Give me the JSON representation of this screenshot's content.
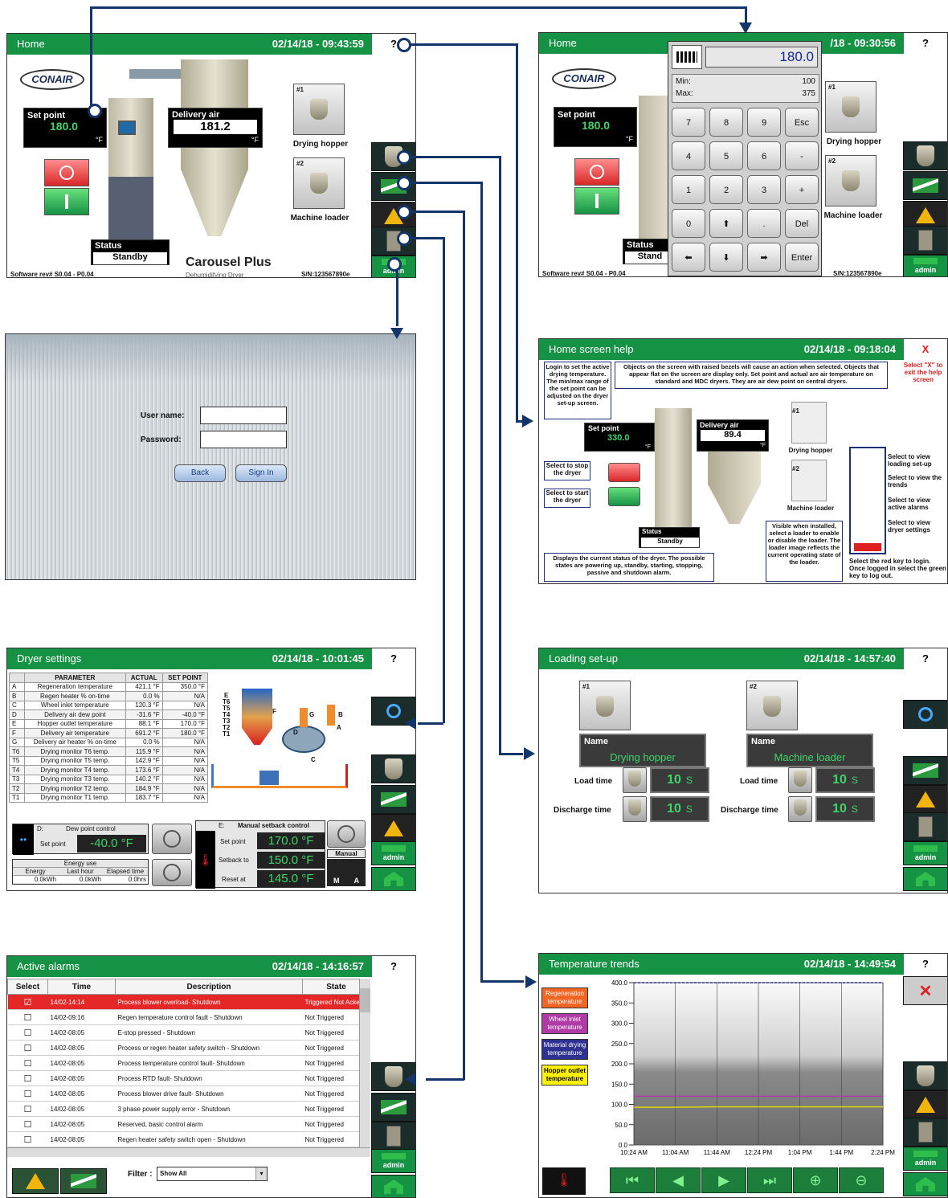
{
  "home": {
    "title": "Home",
    "datetime": "02/14/18 - 09:43:59",
    "help": "?",
    "logo": "CONAIR",
    "setpoint_label": "Set point",
    "setpoint_value": "180.0",
    "unit": "°F",
    "delivery_label": "Delivery air",
    "delivery_value": "181.2",
    "hopper_label": "Drying hopper",
    "loader_label": "Machine loader",
    "hopper_num": "#1",
    "loader_num": "#2",
    "status_label": "Status",
    "status_value": "Standby",
    "brand": "Carousel Plus",
    "brand_sub": "Dehumidifying Dryer",
    "sw": "Software rev# S0.04 - P0.04",
    "sn": "S/N:123567890e",
    "admin": "admin"
  },
  "keypad": {
    "title": "Home",
    "datetime": "/18 - 09:30:56",
    "help": "?",
    "value": "180.0",
    "min_label": "Min:",
    "min_value": "100",
    "max_label": "Max:",
    "max_value": "375",
    "keys": [
      "7",
      "8",
      "9",
      "Esc",
      "4",
      "5",
      "6",
      "-",
      "1",
      "2",
      "3",
      "+",
      "0",
      "⬆",
      ".",
      "Del",
      "⬅",
      "⬇",
      "➡",
      "Enter"
    ],
    "logo": "CONAIR",
    "setpoint_label": "Set point",
    "setpoint_value": "180.0",
    "unit": "°F",
    "hopper_label": "Drying hopper",
    "loader_label": "Machine loader",
    "hopper_num": "#1",
    "loader_num": "#2",
    "status_label": "Status",
    "status_value": "Stand",
    "sw": "Software rev# S0.04 - P0.04",
    "sn": "S/N:123567890e",
    "admin": "admin"
  },
  "login": {
    "user_label": "User name:",
    "pass_label": "Password:",
    "back": "Back",
    "signin": "Sign In"
  },
  "help": {
    "title": "Home screen help",
    "datetime": "02/14/18 - 09:18:04",
    "close": "X",
    "exit_note": "Select \"X\" to exit the help screen",
    "note_login": "Login to set the active drying temperature. The min/max range of the set point can be adjusted on the dryer set-up screen.",
    "note_objects": "Objects on the screen with raised bezels will cause an action when selected. Objects that appear flat on the screen are display only. Set point and actual are air temperature on standard and MDC dryers. They are air dew point on central dryers.",
    "setpoint_label": "Set point",
    "setpoint_value": "330.0",
    "delivery_label": "Delivery air",
    "delivery_value": "89.4",
    "unit": "°F",
    "stop_note": "Select to stop the dryer",
    "start_note": "Select to start the dryer",
    "hopper_label": "Drying hopper",
    "loader_label": "Machine loader",
    "hopper_num": "#1",
    "loader_num": "#2",
    "status_label": "Status",
    "status_value": "Standby",
    "status_note": "Displays the current status of the dryer. The possible states are powering up, standby, starting, stopping, passive and shutdown alarm.",
    "loader_note": "Visible when installed, select a loader to enable or disable the loader. The loader image reflects the current operating state of the loader.",
    "n1": "Select to view loading set-up",
    "n2": "Select to view the trends",
    "n3": "Select to view active alarms",
    "n4": "Select to view dryer settings",
    "key_note": "Select the red key to login. Once logged in select the green key to log out."
  },
  "dryer": {
    "title": "Dryer settings",
    "datetime": "02/14/18 - 10:01:45",
    "help": "?",
    "headers": [
      "PARAMETER",
      "ACTUAL",
      "SET POINT"
    ],
    "rows": [
      [
        "A",
        "Regeneration temperature",
        "421.1 °F",
        "350.0 °F"
      ],
      [
        "B",
        "Regen heater % on-time",
        "0.0 %",
        "N/A"
      ],
      [
        "C",
        "Wheel inlet temperature",
        "120.3 °F",
        "N/A"
      ],
      [
        "D",
        "Delivery air dew point",
        "-31.6 °F",
        "-40.0 °F"
      ],
      [
        "E",
        "Hopper outlet temperature",
        "88.1 °F",
        "170.0 °F"
      ],
      [
        "F",
        "Delivery air temperature",
        "691.2 °F",
        "180.0 °F"
      ],
      [
        "G",
        "Delivery air heater % on-time",
        "0.0 %",
        "N/A"
      ],
      [
        "T6",
        "Drying monitor T6 temp.",
        "115.9 °F",
        "N/A"
      ],
      [
        "T5",
        "Drying monitor T5 temp.",
        "142.9 °F",
        "N/A"
      ],
      [
        "T4",
        "Drying monitor T4 temp.",
        "173.6 °F",
        "N/A"
      ],
      [
        "T3",
        "Drying monitor T3 temp.",
        "140.2 °F",
        "N/A"
      ],
      [
        "T2",
        "Drying monitor T2 temp.",
        "184.9 °F",
        "N/A"
      ],
      [
        "T1",
        "Drying monitor T1 temp.",
        "183.7 °F",
        "N/A"
      ]
    ],
    "dp_tag": "D:",
    "dp_title": "Dew point control",
    "dp_sp_label": "Set point",
    "dp_sp": "-40.0 °F",
    "energy_title": "Energy use",
    "energy_h": [
      "Energy",
      "Last hour",
      "Elapsed time"
    ],
    "energy_v": [
      "0.0kWh",
      "0.0kWh",
      "0.0hrs"
    ],
    "ms_tag": "E:",
    "ms_title": "Manual setback control",
    "ms_sp_label": "Set point",
    "ms_sp": "170.0 °F",
    "ms_sb_label": "Setback to",
    "ms_sb": "150.0 °F",
    "ms_rs_label": "Reset at",
    "ms_rs": "145.0 °F",
    "manual": "Manual",
    "m": "M",
    "a": "A",
    "admin": "admin",
    "diagram_labels": [
      "E",
      "T6",
      "T5",
      "T4",
      "T3",
      "T2",
      "T1",
      "F",
      "G",
      "B",
      "A",
      "D",
      "C"
    ]
  },
  "loading": {
    "title": "Loading set-up",
    "datetime": "02/14/18 - 14:57:40",
    "help": "?",
    "name_label": "Name",
    "l1_num": "#1",
    "l1_name": "Drying hopper",
    "l2_num": "#2",
    "l2_name": "Machine loader",
    "load_label": "Load time",
    "dis_label": "Discharge time",
    "l1_load": "10",
    "l1_dis": "10",
    "l2_load": "10",
    "l2_dis": "10",
    "unit": "S",
    "admin": "admin"
  },
  "alarms": {
    "title": "Active alarms",
    "datetime": "02/14/18 - 14:16:57",
    "help": "?",
    "headers": [
      "Select",
      "Time",
      "Description",
      "State"
    ],
    "rows": [
      [
        "☑",
        "14/02-14:14",
        "Process blower overload- Shutdown",
        "Triggered Not Acked"
      ],
      [
        "☐",
        "14/02-09:16",
        "Regen temperature control fault - Shutdown",
        "Not Triggered"
      ],
      [
        "☐",
        "14/02-08:05",
        "E-stop pressed - Shutdown",
        "Not Triggered"
      ],
      [
        "☐",
        "14/02-08:05",
        "Process or regen heater safety switch - Shutdown",
        "Not Triggered"
      ],
      [
        "☐",
        "14/02-08:05",
        "Process temperature control fault- Shutdown",
        "Not Triggered"
      ],
      [
        "☐",
        "14/02-08:05",
        "Process  RTD fault- Shutdown",
        "Not Triggered"
      ],
      [
        "☐",
        "14/02-08:05",
        "Process blower drive fault- Shutdown",
        "Not Triggered"
      ],
      [
        "☐",
        "14/02-08:05",
        "3 phase power supply error - Shutdown",
        "Not Triggered"
      ],
      [
        "☐",
        "14/02-08:05",
        "Reserved, basic control alarm",
        "Not Triggered"
      ],
      [
        "☐",
        "14/02-08:05",
        "Regen heater safety switch open - Shutdown",
        "Not Triggered"
      ]
    ],
    "filter_label": "Filter :",
    "filter_value": "Show All",
    "admin": "admin"
  },
  "trends": {
    "title": "Temperature trends",
    "datetime": "02/14/18 - 14:49:54",
    "help": "?",
    "admin": "admin",
    "legend": [
      {
        "label": "Regeneration temperature",
        "color": "#f26522"
      },
      {
        "label": "Wheel inlet temperature",
        "color": "#b03aa6"
      },
      {
        "label": "Material drying temperature",
        "color": "#2e3192"
      },
      {
        "label": "Hopper outlet temperature",
        "color": "#fff200"
      }
    ]
  },
  "chart_data": {
    "type": "line",
    "x": [
      "10:24 AM",
      "11:04 AM",
      "11:44 AM",
      "12:24 PM",
      "1:04 PM",
      "1:44 PM",
      "2:24 PM"
    ],
    "ylim": [
      0,
      400
    ],
    "yticks": [
      "0.0",
      "50.0",
      "100.0",
      "150.0",
      "200.0",
      "250.0",
      "300.0",
      "350.0",
      "400.0"
    ],
    "series": [
      {
        "name": "Wheel inlet temperature",
        "color": "#b03aa6",
        "values": [
          120,
          120,
          120,
          120,
          120,
          120,
          120
        ]
      },
      {
        "name": "Hopper outlet temperature",
        "color": "#e8e000",
        "values": [
          93,
          93,
          94,
          94,
          94,
          94,
          94
        ]
      },
      {
        "name": "Regeneration temperature",
        "color": "#2e3192",
        "values": [
          400,
          400,
          400,
          400,
          400,
          400,
          400
        ]
      }
    ]
  }
}
